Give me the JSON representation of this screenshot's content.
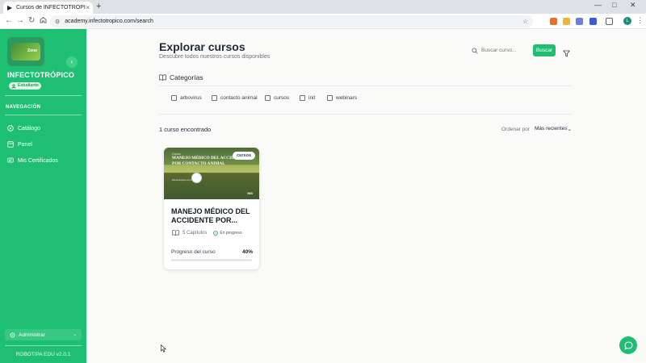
{
  "browser": {
    "tab_title": "Cursos de INFECTOTRÓPICO",
    "tab_close": "×",
    "new_tab": "+",
    "url": "academy.infectotropico.com/search",
    "profile_initial": "L",
    "window_controls": {
      "minimize": "—",
      "maximize": "□",
      "close": "✕"
    }
  },
  "sidebar": {
    "brand": "INFECTOTRÓPICO",
    "role_badge": "Estudiante",
    "logo_text": "Zone",
    "collapse_icon": "‹",
    "nav_heading": "NAVEGACIÓN",
    "items": [
      {
        "label": "Catálogo",
        "icon": "compass-icon"
      },
      {
        "label": "Panel",
        "icon": "panel-icon"
      },
      {
        "label": "Mis Certificados",
        "icon": "certificate-icon"
      }
    ],
    "admin_label": "Administrar",
    "admin_chevron": "⌄",
    "version": "ROBOTIPA EDU v2.0.1"
  },
  "main": {
    "title": "Explorar cursos",
    "subtitle": "Descubre todos nuestros cursos disponibles",
    "search_placeholder": "Buscar curso...",
    "search_button": "Buscar",
    "categories_heading": "Categorías",
    "categories": [
      "arbovirus",
      "contacto animal",
      "cursos",
      "init",
      "webinars"
    ],
    "results_count": "1 curso encontrado",
    "order_label": "Ordenar por",
    "order_value": "Más recientes",
    "order_chevron": "⌄"
  },
  "course_card": {
    "badge": "cursos",
    "image_kicker": "Curso",
    "image_title": "MANEJO MÉDICO DEL ACCIDENTE POR CONTACTO ANIMAL",
    "image_small": "infectotropico.com",
    "image_institution": "INS",
    "title": "MANEJO MÉDICO DEL ACCIDENTE POR...",
    "chapters": "5 Capítulos",
    "status": "En progreso",
    "progress_label": "Progreso del curso",
    "progress_value": "40%",
    "progress_fraction": 0.4
  },
  "colors": {
    "brand_green": "#1fbf73",
    "sidebar_dark": "#2a9a60",
    "text_dark": "#1f2937",
    "muted": "#6b7280"
  }
}
